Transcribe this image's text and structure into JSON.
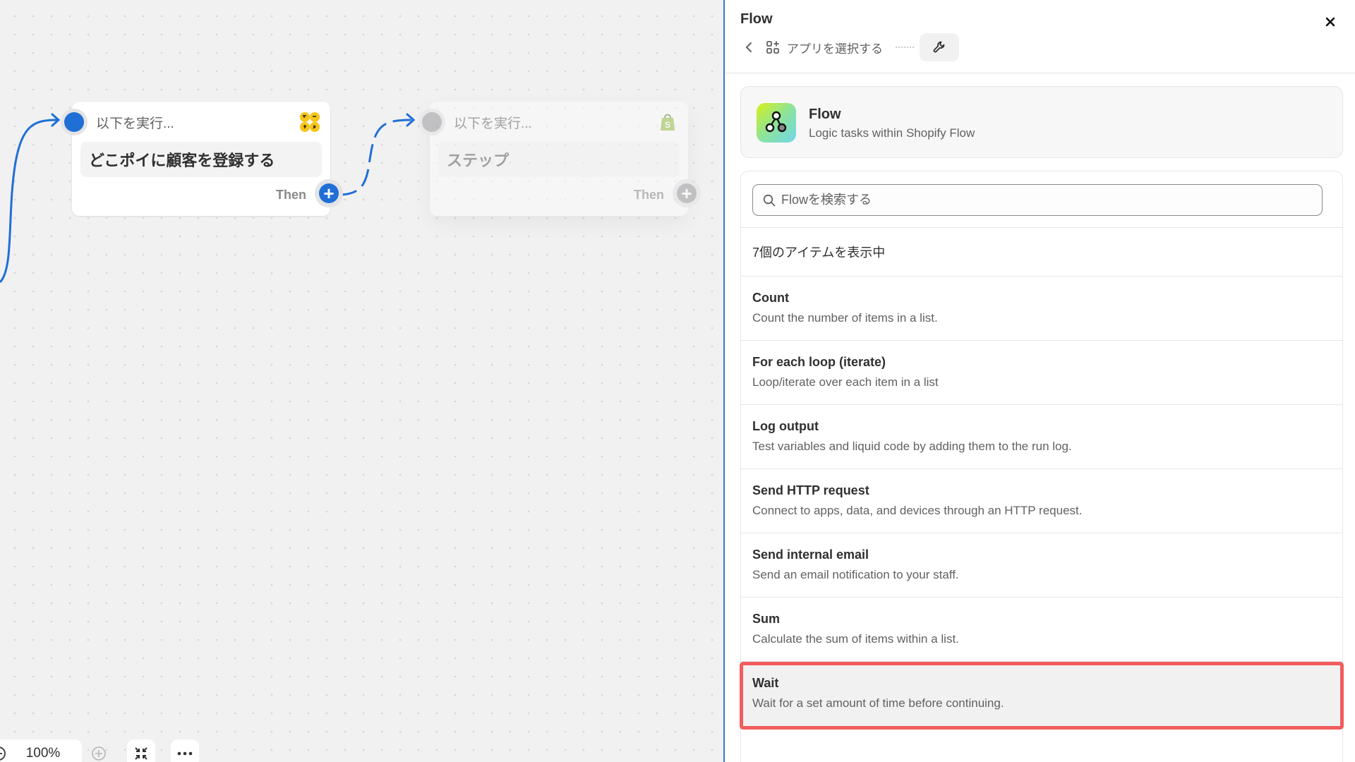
{
  "canvas": {
    "nodes": [
      {
        "header": "以下を実行...",
        "title": "どこポイに顧客を登録する",
        "then_label": "Then",
        "icon": "dokopoi-app-icon",
        "state": "active"
      },
      {
        "header": "以下を実行...",
        "title": "ステップ",
        "then_label": "Then",
        "icon": "shopify-bag-icon",
        "state": "placeholder"
      }
    ],
    "zoom": {
      "value": "100%"
    },
    "colors": {
      "connector": "#1f6fd6",
      "canvas_bg": "#f1f1f1"
    }
  },
  "panel": {
    "title": "Flow",
    "close_label": "×",
    "breadcrumb": {
      "back_label": "‹",
      "app_select_label": "アプリを選択する",
      "tool_icon": "wrench-icon"
    },
    "app": {
      "name": "Flow",
      "description": "Logic tasks within Shopify Flow"
    },
    "search": {
      "placeholder": "Flowを検索する",
      "value": ""
    },
    "result_count": "7個のアイテムを表示中",
    "items": [
      {
        "title": "Count",
        "description": "Count the number of items in a list."
      },
      {
        "title": "For each loop (iterate)",
        "description": "Loop/iterate over each item in a list"
      },
      {
        "title": "Log output",
        "description": "Test variables and liquid code by adding them to the run log."
      },
      {
        "title": "Send HTTP request",
        "description": "Connect to apps, data, and devices through an HTTP request."
      },
      {
        "title": "Send internal email",
        "description": "Send an email notification to your staff."
      },
      {
        "title": "Sum",
        "description": "Calculate the sum of items within a list."
      },
      {
        "title": "Wait",
        "description": "Wait for a set amount of time before continuing.",
        "highlighted": true
      }
    ],
    "colors": {
      "accent_border": "#3d73d8",
      "highlight": "#f25c5c"
    }
  }
}
